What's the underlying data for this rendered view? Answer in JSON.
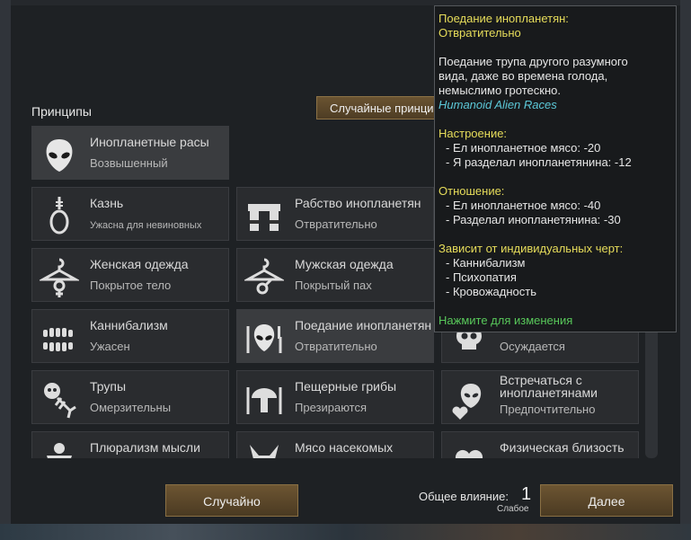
{
  "principles": {
    "title": "Принципы",
    "random_button": "Случайные принципы",
    "meme": {
      "title": "Инопланетные расы",
      "value": "Возвышенный",
      "icon": "alien-head-icon"
    },
    "cards": [
      {
        "title": "Казнь",
        "value": "Ужасна для невиновных",
        "icon": "noose-icon"
      },
      {
        "title": "Рабство инопланетян",
        "value": "Отвратительно",
        "icon": "shackles-icon"
      },
      {
        "title": "Женская одежда",
        "value": "Покрытое тело",
        "icon": "female-hanger-icon"
      },
      {
        "title": "Мужская одежда",
        "value": "Покрытый пах",
        "icon": "male-hanger-icon"
      },
      {
        "title": "Каннибализм",
        "value": "Ужасен",
        "icon": "teeth-icon"
      },
      {
        "title": "Поедание инопланетян",
        "value": "Отвратительно",
        "icon": "alien-eating-icon"
      },
      {
        "title": "",
        "value": "Осуждается",
        "icon": "skull-icon"
      },
      {
        "title": "Трупы",
        "value": "Омерзительны",
        "icon": "skeleton-icon"
      },
      {
        "title": "Пещерные грибы",
        "value": "Презираются",
        "icon": "mushroom-icon"
      },
      {
        "title": "Встречаться с инопланетянами",
        "value": "Предпочтительно",
        "icon": "alien-heart-icon"
      },
      {
        "title": "Плюрализм мысли",
        "value": "",
        "icon": "pluralism-icon"
      },
      {
        "title": "Мясо насекомых",
        "value": "",
        "icon": "insect-icon"
      },
      {
        "title": "Физическая близость",
        "value": "",
        "icon": "heart-icon"
      }
    ]
  },
  "tooltip": {
    "heading1": "Поедание инопланетян:",
    "heading2": "Отвратительно",
    "desc1": "Поедание трупа другого разумного",
    "desc2": "вида, даже во времена голода,",
    "desc3": "немыслимо гротескно.",
    "mod": "Humanoid Alien Races",
    "mood_title": "Настроение:",
    "mood1": "- Ел инопланетное мясо: -20",
    "mood2": "- Я разделал инопланетянина: -12",
    "opinion_title": "Отношение:",
    "opinion1": "- Ел инопланетное мясо: -40",
    "opinion2": "- Разделал инопланетянина: -30",
    "traits_title": "Зависит от индивидуальных черт:",
    "trait1": "- Каннибализм",
    "trait2": "- Психопатия",
    "trait3": "- Кровожадность",
    "click_hint": "Нажмите для изменения"
  },
  "footer": {
    "random_button": "Случайно",
    "influence_label": "Общее влияние:",
    "influence_value": "1",
    "influence_level": "Слабое",
    "next_button": "Далее"
  }
}
